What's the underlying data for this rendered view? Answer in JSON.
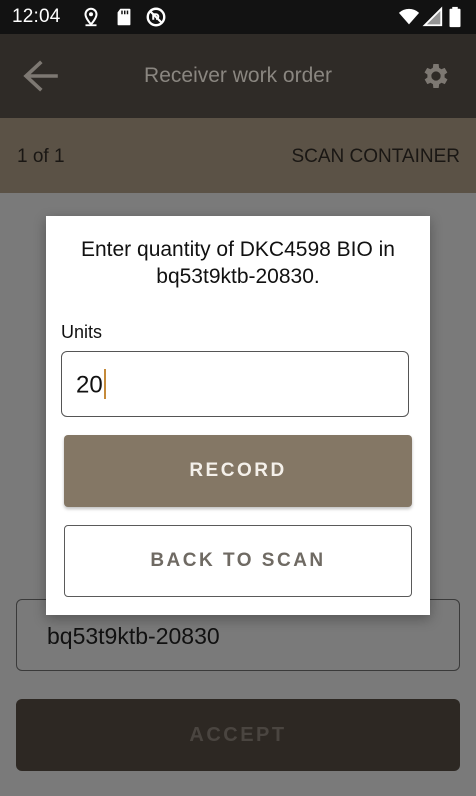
{
  "status_bar": {
    "time": "12:04",
    "left_icons": [
      "location-icon",
      "sd-card-icon",
      "no-data-icon"
    ],
    "right_icons": [
      "wifi-icon",
      "cell-signal-icon",
      "battery-icon"
    ]
  },
  "app_bar": {
    "title": "Receiver work order",
    "back_icon": "arrow-back-icon",
    "settings_icon": "gear-icon"
  },
  "sub_header": {
    "page_count": "1 of 1",
    "action_label": "SCAN CONTAINER"
  },
  "main": {
    "container_value": "bq53t9ktb-20830",
    "accept_label": "ACCEPT"
  },
  "dialog": {
    "message": "Enter quantity of DKC4598 BIO in bq53t9ktb-20830.",
    "units_label": "Units",
    "units_value": "20",
    "record_label": "RECORD",
    "back_to_scan_label": "BACK TO SCAN"
  },
  "colors": {
    "status_bar": "#121212",
    "app_bar": "#2f2b27",
    "sub_header": "#5b5246",
    "record_button": "#847765",
    "caret": "#c58a3a"
  }
}
